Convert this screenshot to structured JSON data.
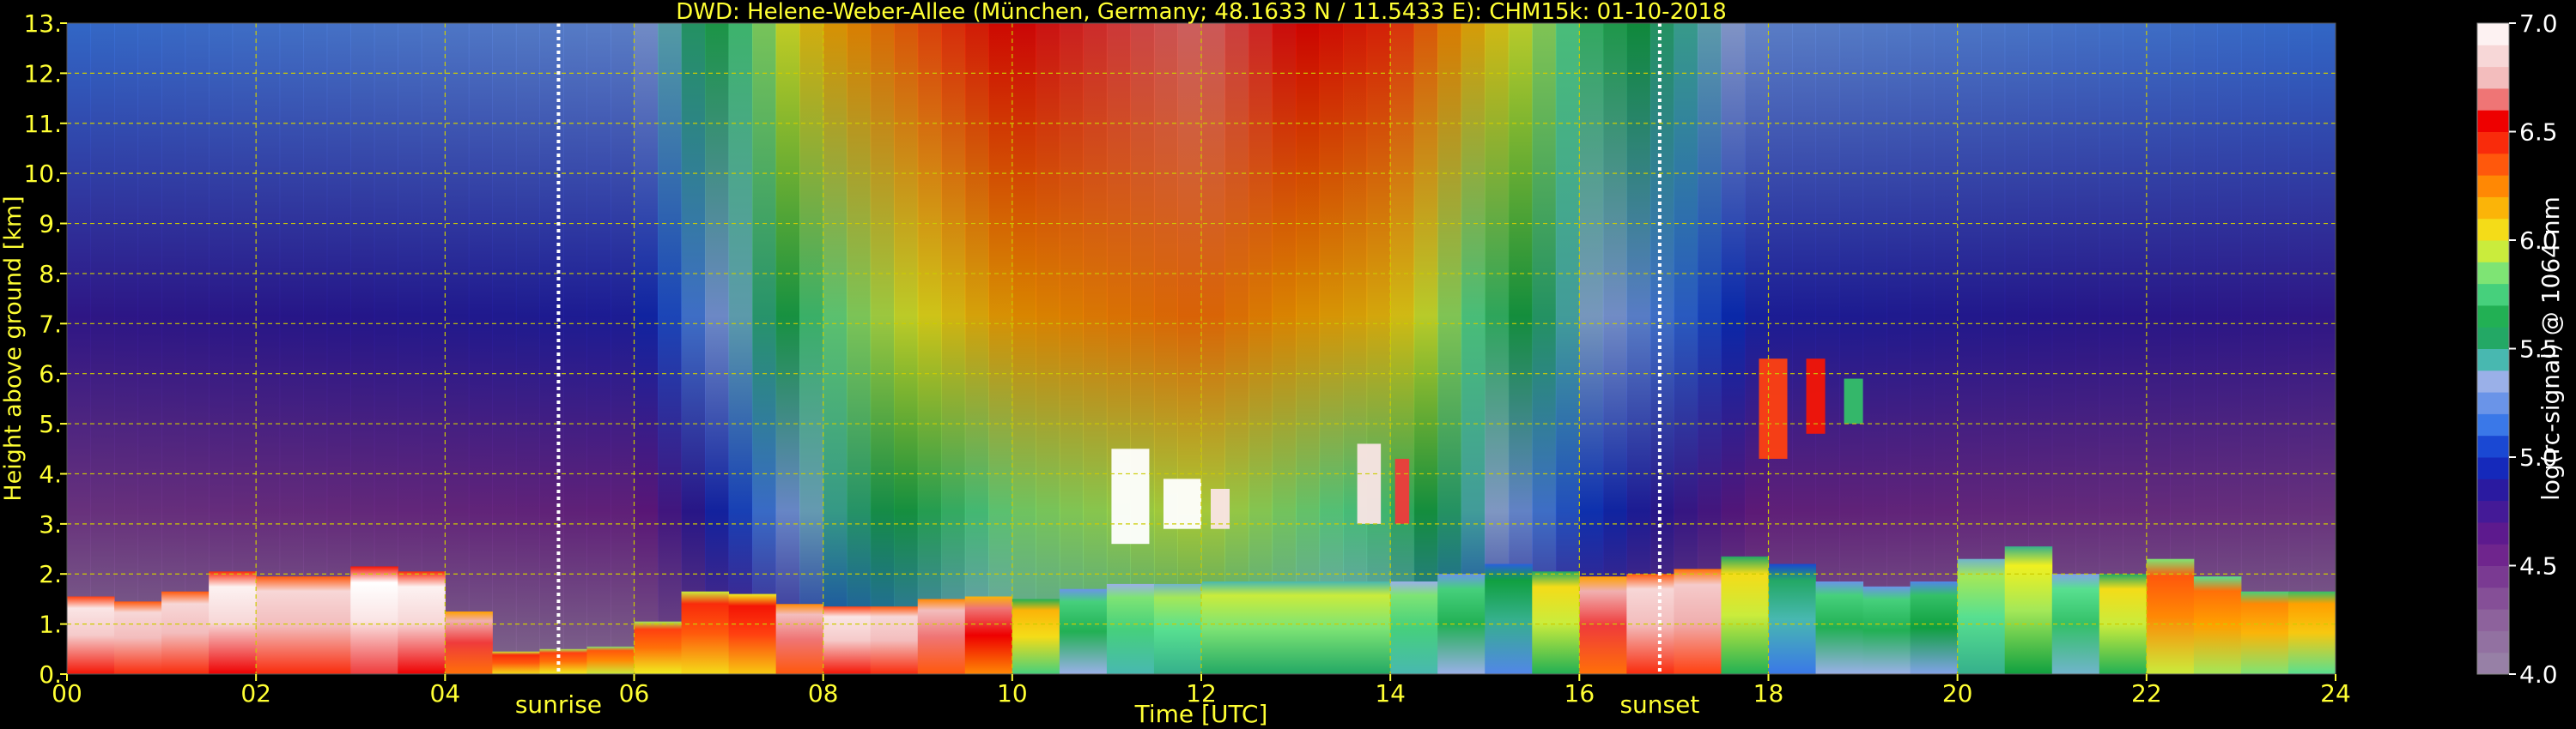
{
  "chart_data": {
    "type": "heatmap",
    "title": "DWD: Helene-Weber-Allee (München, Germany; 48.1633 N / 11.5433 E):    CHM15k: 01-10-2018",
    "xlabel": "Time [UTC]",
    "ylabel": "Height above ground [km]",
    "xlim": [
      0,
      24
    ],
    "ylim": [
      0,
      13
    ],
    "x_ticks": [
      0,
      2,
      4,
      6,
      8,
      10,
      12,
      14,
      16,
      18,
      20,
      22,
      24
    ],
    "x_tick_labels": [
      "00",
      "02",
      "04",
      "06",
      "08",
      "10",
      "12",
      "14",
      "16",
      "18",
      "20",
      "22",
      "24"
    ],
    "y_ticks": [
      0,
      1,
      2,
      3,
      4,
      5,
      6,
      7,
      8,
      9,
      10,
      11,
      12,
      13
    ],
    "y_tick_labels": [
      "0.",
      "1.",
      "2.",
      "3.",
      "4.",
      "5.",
      "6.",
      "7.",
      "8.",
      "9.",
      "10.",
      "11.",
      "12.",
      "13."
    ],
    "grid": true,
    "annotations": [
      {
        "label": "sunrise",
        "x": 5.2
      },
      {
        "label": "sunset",
        "x": 16.85
      }
    ],
    "colorbar": {
      "label": "log(rc-signal) @ 1064 nm",
      "range": [
        4.0,
        7.0
      ],
      "ticks": [
        4.0,
        4.5,
        5.0,
        5.5,
        6.0,
        6.5,
        7.0
      ],
      "tick_labels": [
        "4.0",
        "4.5",
        "5.0",
        "5.5",
        "6.0",
        "6.5",
        "7.0"
      ]
    },
    "background_signal": [
      {
        "x": 0,
        "level": 5.0
      },
      {
        "x": 6,
        "level": 5.1
      },
      {
        "x": 8,
        "level": 6.0
      },
      {
        "x": 10,
        "level": 6.4
      },
      {
        "x": 12,
        "level": 6.5
      },
      {
        "x": 14,
        "level": 6.3
      },
      {
        "x": 16,
        "level": 5.6
      },
      {
        "x": 18,
        "level": 5.1
      },
      {
        "x": 24,
        "level": 5.0
      }
    ],
    "boundary_layer": [
      {
        "x": 0.0,
        "top": 1.6,
        "level": 6.8
      },
      {
        "x": 0.5,
        "top": 1.5,
        "level": 6.8
      },
      {
        "x": 1.0,
        "top": 1.4,
        "level": 6.7
      },
      {
        "x": 1.5,
        "top": 1.9,
        "level": 6.8
      },
      {
        "x": 2.0,
        "top": 2.2,
        "level": 6.9
      },
      {
        "x": 2.5,
        "top": 1.7,
        "level": 6.6
      },
      {
        "x": 3.0,
        "top": 2.2,
        "level": 6.9
      },
      {
        "x": 3.5,
        "top": 2.1,
        "level": 6.9
      },
      {
        "x": 4.0,
        "top": 2.0,
        "level": 6.8
      },
      {
        "x": 4.5,
        "top": 0.5,
        "level": 6.4
      },
      {
        "x": 5.0,
        "top": 0.4,
        "level": 6.3
      },
      {
        "x": 5.5,
        "top": 0.6,
        "level": 6.3
      },
      {
        "x": 6.0,
        "top": 0.5,
        "level": 6.2
      },
      {
        "x": 6.5,
        "top": 1.6,
        "level": 6.4
      },
      {
        "x": 7.0,
        "top": 1.7,
        "level": 6.3
      },
      {
        "x": 7.5,
        "top": 1.5,
        "level": 6.5
      },
      {
        "x": 8.0,
        "top": 1.3,
        "level": 6.8
      },
      {
        "x": 8.5,
        "top": 1.4,
        "level": 6.8
      },
      {
        "x": 9.0,
        "top": 1.3,
        "level": 6.7
      },
      {
        "x": 9.5,
        "top": 1.7,
        "level": 6.6
      },
      {
        "x": 10.0,
        "top": 1.4,
        "level": 6.5
      },
      {
        "x": 10.5,
        "top": 1.6,
        "level": 5.6
      },
      {
        "x": 11.0,
        "top": 1.8,
        "level": 5.7
      },
      {
        "x": 11.5,
        "top": 1.8,
        "level": 5.8
      },
      {
        "x": 12.0,
        "top": 1.8,
        "level": 5.8
      },
      {
        "x": 12.5,
        "top": 1.9,
        "level": 5.9
      },
      {
        "x": 13.0,
        "top": 1.8,
        "level": 5.8
      },
      {
        "x": 13.5,
        "top": 1.9,
        "level": 5.9
      },
      {
        "x": 14.0,
        "top": 1.8,
        "level": 5.8
      },
      {
        "x": 14.5,
        "top": 1.9,
        "level": 5.7
      },
      {
        "x": 15.0,
        "top": 2.1,
        "level": 5.6
      },
      {
        "x": 15.5,
        "top": 2.3,
        "level": 5.4
      },
      {
        "x": 16.0,
        "top": 1.8,
        "level": 6.5
      },
      {
        "x": 16.5,
        "top": 2.1,
        "level": 6.7
      },
      {
        "x": 17.0,
        "top": 1.9,
        "level": 6.8
      },
      {
        "x": 17.5,
        "top": 2.3,
        "level": 6.6
      },
      {
        "x": 18.0,
        "top": 2.4,
        "level": 5.3
      },
      {
        "x": 18.5,
        "top": 2.0,
        "level": 5.6
      },
      {
        "x": 19.0,
        "top": 1.7,
        "level": 5.7
      },
      {
        "x": 19.5,
        "top": 1.8,
        "level": 5.6
      },
      {
        "x": 20.0,
        "top": 1.9,
        "level": 5.6
      },
      {
        "x": 20.5,
        "top": 2.7,
        "level": 6.0
      },
      {
        "x": 21.0,
        "top": 2.4,
        "level": 5.8
      },
      {
        "x": 21.5,
        "top": 1.6,
        "level": 5.6
      },
      {
        "x": 22.0,
        "top": 2.4,
        "level": 6.3
      },
      {
        "x": 22.5,
        "top": 2.2,
        "level": 6.2
      },
      {
        "x": 23.0,
        "top": 1.7,
        "level": 6.2
      },
      {
        "x": 23.5,
        "top": 1.6,
        "level": 6.1
      },
      {
        "x": 24.0,
        "top": 1.7,
        "level": 6.1
      }
    ],
    "cloud_features": [
      {
        "x0": 11.05,
        "x1": 11.45,
        "y0": 2.6,
        "y1": 4.5,
        "level": 7.0
      },
      {
        "x0": 11.6,
        "x1": 12.0,
        "y0": 2.9,
        "y1": 3.9,
        "level": 7.0
      },
      {
        "x0": 12.1,
        "x1": 12.3,
        "y0": 2.9,
        "y1": 3.7,
        "level": 6.9
      },
      {
        "x0": 13.65,
        "x1": 13.9,
        "y0": 3.0,
        "y1": 4.6,
        "level": 6.9
      },
      {
        "x0": 14.05,
        "x1": 14.2,
        "y0": 3.0,
        "y1": 4.3,
        "level": 6.6
      },
      {
        "x0": 17.9,
        "x1": 18.2,
        "y0": 4.3,
        "y1": 6.3,
        "level": 6.4
      },
      {
        "x0": 18.4,
        "x1": 18.6,
        "y0": 4.8,
        "y1": 6.3,
        "level": 6.5
      },
      {
        "x0": 18.8,
        "x1": 19.0,
        "y0": 5.0,
        "y1": 5.9,
        "level": 5.7
      }
    ]
  }
}
